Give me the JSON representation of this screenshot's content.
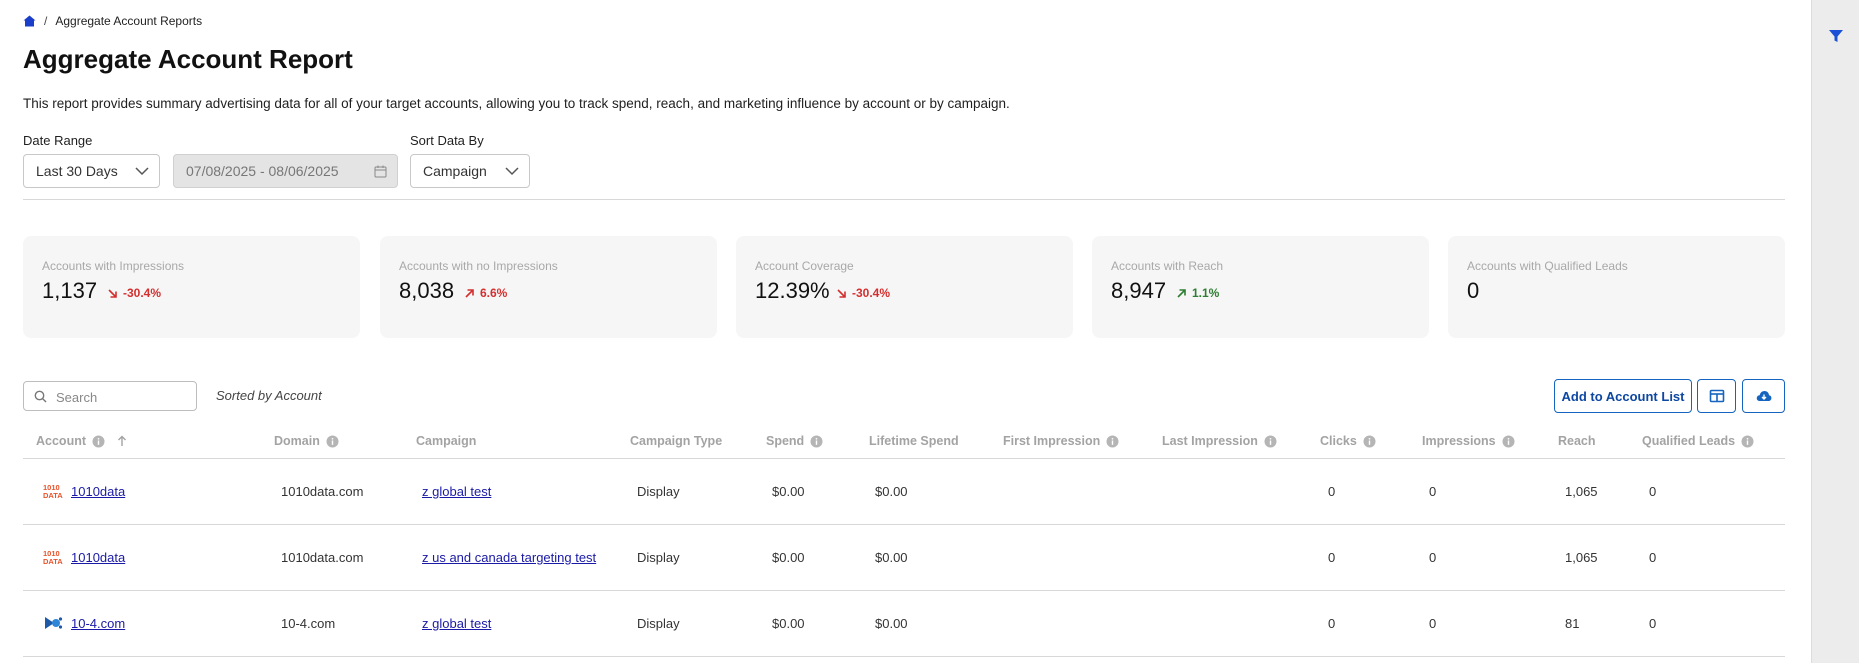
{
  "breadcrumb": {
    "current": "Aggregate Account Reports",
    "separator": "/"
  },
  "page": {
    "title": "Aggregate Account Report",
    "description": "This report provides summary advertising data for all of your target accounts, allowing you to track spend, reach, and marketing influence by account or by campaign."
  },
  "filters": {
    "date_range_label": "Date Range",
    "date_range_value": "Last 30 Days",
    "date_input_value": "07/08/2025 - 08/06/2025",
    "sort_label": "Sort Data By",
    "sort_value": "Campaign"
  },
  "stats": [
    {
      "label": "Accounts with Impressions",
      "value": "1,137",
      "delta": "-30.4%",
      "direction": "down",
      "color": "#d32f2f"
    },
    {
      "label": "Accounts with no Impressions",
      "value": "8,038",
      "delta": "6.6%",
      "direction": "up",
      "color": "#d32f2f"
    },
    {
      "label": "Account Coverage",
      "value": "12.39%",
      "delta": "-30.4%",
      "direction": "down",
      "color": "#d32f2f"
    },
    {
      "label": "Accounts with Reach",
      "value": "8,947",
      "delta": "1.1%",
      "direction": "up",
      "color": "#2e7d32"
    },
    {
      "label": "Accounts with Qualified Leads",
      "value": "0",
      "delta": "",
      "direction": "",
      "color": ""
    }
  ],
  "table_tools": {
    "search_placeholder": "Search",
    "sorted_by": "Sorted by Account",
    "add_to_list_label": "Add to Account List",
    "columns_icon": "columns-icon",
    "download_icon": "cloud-download-icon"
  },
  "columns": {
    "account": "Account",
    "domain": "Domain",
    "campaign": "Campaign",
    "campaign_type": "Campaign Type",
    "spend": "Spend",
    "lifetime_spend": "Lifetime Spend",
    "first_impression": "First Impression",
    "last_impression": "Last Impression",
    "clicks": "Clicks",
    "impressions": "Impressions",
    "reach": "Reach",
    "qualified_leads": "Qualified Leads"
  },
  "rows": [
    {
      "account": "1010data",
      "domain": "1010data.com",
      "campaign": "z global test",
      "campaign_type": "Display",
      "spend": "$0.00",
      "lifetime_spend": "$0.00",
      "first_impression": "",
      "last_impression": "",
      "clicks": "0",
      "impressions": "0",
      "reach": "1,065",
      "qualified_leads": "0",
      "logo": "1010data-logo"
    },
    {
      "account": "1010data",
      "domain": "1010data.com",
      "campaign": "z us and canada targeting test",
      "campaign_type": "Display",
      "spend": "$0.00",
      "lifetime_spend": "$0.00",
      "first_impression": "",
      "last_impression": "",
      "clicks": "0",
      "impressions": "0",
      "reach": "1,065",
      "qualified_leads": "0",
      "logo": "1010data-logo"
    },
    {
      "account": "10-4.com",
      "domain": "10-4.com",
      "campaign": "z global test",
      "campaign_type": "Display",
      "spend": "$0.00",
      "lifetime_spend": "$0.00",
      "first_impression": "",
      "last_impression": "",
      "clicks": "0",
      "impressions": "0",
      "reach": "81",
      "qualified_leads": "0",
      "logo": "10-4-logo"
    }
  ],
  "colors": {
    "accent": "#1565c0",
    "link": "#1a1aa6",
    "negative": "#d32f2f",
    "positive": "#2e7d32"
  }
}
